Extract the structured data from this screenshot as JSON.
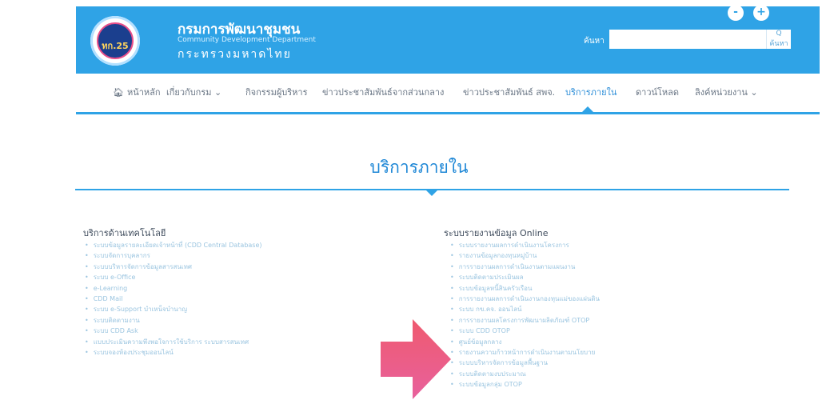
{
  "header": {
    "logo_text": "ทก.25",
    "org_name": "กรมการพัฒนาชุมชน",
    "org_sub": "Community Development Department",
    "org_ministry": "กระทรวงมหาดไทย",
    "search_label": "ค้นหา",
    "search_placeholder": "",
    "search_button": "Q ค้นหา",
    "zoom_out": "-",
    "zoom_in": "+"
  },
  "nav": {
    "items": [
      {
        "label": "หน้าหลัก",
        "icon": "home-icon"
      },
      {
        "label": "เกี่ยวกับกรม ⌄"
      },
      {
        "label": "กิจกรรมผู้บริหาร"
      },
      {
        "label": "ข่าวประชาสัมพันธ์จากส่วนกลาง"
      },
      {
        "label": "ข่าวประชาสัมพันธ์ สพจ."
      },
      {
        "label": "บริการภายใน",
        "active": true
      },
      {
        "label": "ดาวน์โหลด"
      },
      {
        "label": "ลิงค์หน่วยงาน ⌄"
      }
    ]
  },
  "main": {
    "title": "บริการภายใน",
    "left_column": {
      "heading": "บริการด้านเทคโนโลยี",
      "items": [
        "ระบบข้อมูลรายละเอียดเจ้าหน้าที่ (CDD Central Database)",
        "ระบบจัดการบุคลากร",
        "ระบบบริหารจัดการข้อมูลสารสนเทศ",
        "ระบบ e-Office",
        "e-Learning",
        "CDD Mail",
        "ระบบ e-Support บำเหน็จบำนาญ",
        "ระบบติดตามงาน",
        "ระบบ CDD Ask",
        "แบบประเมินความพึงพอใจการใช้บริการ ระบบสารสนเทศ",
        "ระบบจองห้องประชุมออนไลน์"
      ]
    },
    "right_column": {
      "heading": "ระบบรายงานข้อมูล Online",
      "items": [
        "ระบบรายงานผลการดำเนินงานโครงการ",
        "รายงานข้อมูลกองทุนหมู่บ้าน",
        "การรายงานผลการดำเนินงานตามแผนงาน",
        "ระบบติดตามประเมินผล",
        "ระบบข้อมูลหนี้สินครัวเรือน",
        "การรายงานผลการดำเนินงานกองทุนแม่ของแผ่นดิน",
        "ระบบ กข.คจ. ออนไลน์",
        "การรายงานผลโครงการพัฒนาผลิตภัณฑ์ OTOP",
        "ระบบ CDD OTOP",
        "ศูนย์ข้อมูลกลาง",
        "รายงานความก้าวหน้าการดำเนินงานตามนโยบาย",
        "ระบบบริหารจัดการข้อมูลพื้นฐาน",
        "ระบบติดตามงบประมาณ",
        "ระบบข้อมูลกลุ่ม OTOP"
      ]
    }
  },
  "colors": {
    "header_bg": "#2fa3e6",
    "accent": "#1e87d6",
    "arrow_top": "#ef5a6f",
    "arrow_bottom": "#e8619d"
  }
}
